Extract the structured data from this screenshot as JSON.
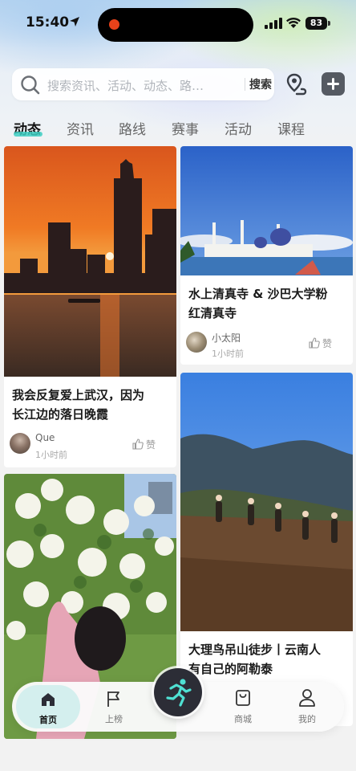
{
  "status_bar": {
    "time": "15:40",
    "battery": "83"
  },
  "search": {
    "placeholder": "搜索资讯、活动、动态、路…",
    "button": "搜索"
  },
  "icons": {
    "route": "route-icon",
    "add": "plus-icon"
  },
  "tabs": [
    {
      "label": "动态",
      "active": true
    },
    {
      "label": "资讯"
    },
    {
      "label": "路线"
    },
    {
      "label": "赛事"
    },
    {
      "label": "活动"
    },
    {
      "label": "课程"
    }
  ],
  "feed": {
    "card1": {
      "title_line1": "我会反复爱上武汉，因为",
      "title_line2": "长江边的落日晚霞",
      "author": "Que",
      "time": "1小时前",
      "like": "赞"
    },
    "card2": {
      "title_line1": "水上清真寺 & 沙巴大学粉",
      "title_line2": "红清真寺",
      "author": "小太阳",
      "time": "1小时前",
      "like": "赞"
    },
    "card3": {
      "title_line1": "大理鸟吊山徒步丨云南人",
      "title_line2": "有自己的阿勒泰"
    }
  },
  "bottom_nav": [
    {
      "label": "首页",
      "icon": "home-icon",
      "active": true
    },
    {
      "label": "上榜",
      "icon": "flag-icon"
    },
    {
      "label": "",
      "icon": "running-icon"
    },
    {
      "label": "商城",
      "icon": "shop-icon"
    },
    {
      "label": "我的",
      "icon": "profile-icon"
    }
  ],
  "colors": {
    "accent": "#3ecfc2",
    "nav_active_bg": "#d4efee"
  }
}
